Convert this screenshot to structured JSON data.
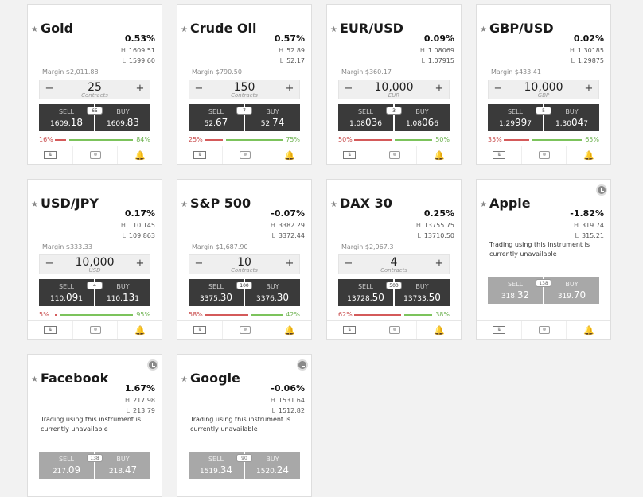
{
  "cards": [
    {
      "key": "gold",
      "name": "Gold",
      "change": "0.53%",
      "high": "1609.51",
      "low": "1599.60",
      "margin": "Margin $2,011.88",
      "qty": "25",
      "unit": "Contracts",
      "sell_label": "SELL",
      "sell_main": "1609.",
      "sell_big": "18",
      "buy_label": "BUY",
      "buy_main": "1609.",
      "buy_big": "83",
      "spread": "65",
      "sell_pct": "16%",
      "buy_pct": "84%",
      "sell_frac": 0.16
    },
    {
      "key": "crude",
      "name": "Crude Oil",
      "change": "0.57%",
      "high": "52.89",
      "low": "52.17",
      "margin": "Margin $790.50",
      "qty": "150",
      "unit": "Contracts",
      "sell_label": "SELL",
      "sell_main": "52.",
      "sell_big": "67",
      "buy_label": "BUY",
      "buy_main": "52.",
      "buy_big": "74",
      "spread": "7",
      "sell_pct": "25%",
      "buy_pct": "75%",
      "sell_frac": 0.25
    },
    {
      "key": "eurusd",
      "name": "EUR/USD",
      "change": "0.09%",
      "high": "1.08069",
      "low": "1.07915",
      "margin": "Margin $360.17",
      "qty": "10,000",
      "unit": "EUR",
      "sell_label": "SELL",
      "sell_main": "1.08",
      "sell_big": "03",
      "sell_tail": "6",
      "buy_label": "BUY",
      "buy_main": "1.08",
      "buy_big": "06",
      "buy_tail": "6",
      "spread": "3",
      "sell_pct": "50%",
      "buy_pct": "50%",
      "sell_frac": 0.5
    },
    {
      "key": "gbpusd",
      "name": "GBP/USD",
      "change": "0.02%",
      "high": "1.30185",
      "low": "1.29875",
      "margin": "Margin $433.41",
      "qty": "10,000",
      "unit": "GBP",
      "sell_label": "SELL",
      "sell_main": "1.29",
      "sell_big": "99",
      "sell_tail": "7",
      "buy_label": "BUY",
      "buy_main": "1.30",
      "buy_big": "04",
      "buy_tail": "7",
      "spread": "5",
      "sell_pct": "35%",
      "buy_pct": "65%",
      "sell_frac": 0.35
    },
    {
      "key": "usdjpy",
      "name": "USD/JPY",
      "change": "0.17%",
      "high": "110.145",
      "low": "109.863",
      "margin": "Margin $333.33",
      "qty": "10,000",
      "unit": "USD",
      "sell_label": "SELL",
      "sell_main": "110.",
      "sell_big": "09",
      "sell_tail": "1",
      "buy_label": "BUY",
      "buy_main": "110.",
      "buy_big": "13",
      "buy_tail": "1",
      "spread": "4",
      "sell_pct": "5%",
      "buy_pct": "95%",
      "sell_frac": 0.05
    },
    {
      "key": "sp500",
      "name": "S&P 500",
      "change": "-0.07%",
      "high": "3382.29",
      "low": "3372.44",
      "margin": "Margin $1,687.90",
      "qty": "10",
      "unit": "Contracts",
      "sell_label": "SELL",
      "sell_main": "3375.",
      "sell_big": "30",
      "buy_label": "BUY",
      "buy_main": "3376.",
      "buy_big": "30",
      "spread": "100",
      "sell_pct": "58%",
      "buy_pct": "42%",
      "sell_frac": 0.58
    },
    {
      "key": "dax30",
      "name": "DAX 30",
      "change": "0.25%",
      "high": "13755.75",
      "low": "13710.50",
      "margin": "Margin $2,967.3",
      "qty": "4",
      "unit": "Contracts",
      "sell_label": "SELL",
      "sell_main": "13728.",
      "sell_big": "50",
      "buy_label": "BUY",
      "buy_main": "13733.",
      "buy_big": "50",
      "spread": "500",
      "sell_pct": "62%",
      "buy_pct": "38%",
      "sell_frac": 0.62
    },
    {
      "key": "apple",
      "name": "Apple",
      "change": "-1.82%",
      "high": "319.74",
      "low": "315.21",
      "unavailable": "Trading using this instrument is currently unavailable",
      "sell_label": "SELL",
      "sell_main": "318.",
      "sell_big": "32",
      "buy_label": "BUY",
      "buy_main": "319.",
      "buy_big": "70",
      "spread": "138"
    },
    {
      "key": "facebook",
      "name": "Facebook",
      "change": "1.67%",
      "high": "217.98",
      "low": "213.79",
      "unavailable": "Trading using this instrument is currently unavailable",
      "sell_label": "SELL",
      "sell_main": "217.",
      "sell_big": "09",
      "buy_label": "BUY",
      "buy_main": "218.",
      "buy_big": "47",
      "spread": "138"
    },
    {
      "key": "google",
      "name": "Google",
      "change": "-0.06%",
      "high": "1531.64",
      "low": "1512.82",
      "unavailable": "Trading using this instrument is currently unavailable",
      "sell_label": "SELL",
      "sell_main": "1519.",
      "sell_big": "34",
      "buy_label": "BUY",
      "buy_main": "1520.",
      "buy_big": "24",
      "spread": "90"
    }
  ],
  "labels": {
    "high_prefix": "H",
    "low_prefix": "L",
    "minus": "−",
    "plus": "+"
  },
  "icons": [
    "star-icon",
    "trade-icon",
    "chart-icon",
    "bell-icon",
    "clock-icon"
  ],
  "colors": {
    "sell": "#d45a5a",
    "buy": "#7cc35c",
    "button": "#3a3a3a",
    "disabled": "#a8a8a8"
  }
}
